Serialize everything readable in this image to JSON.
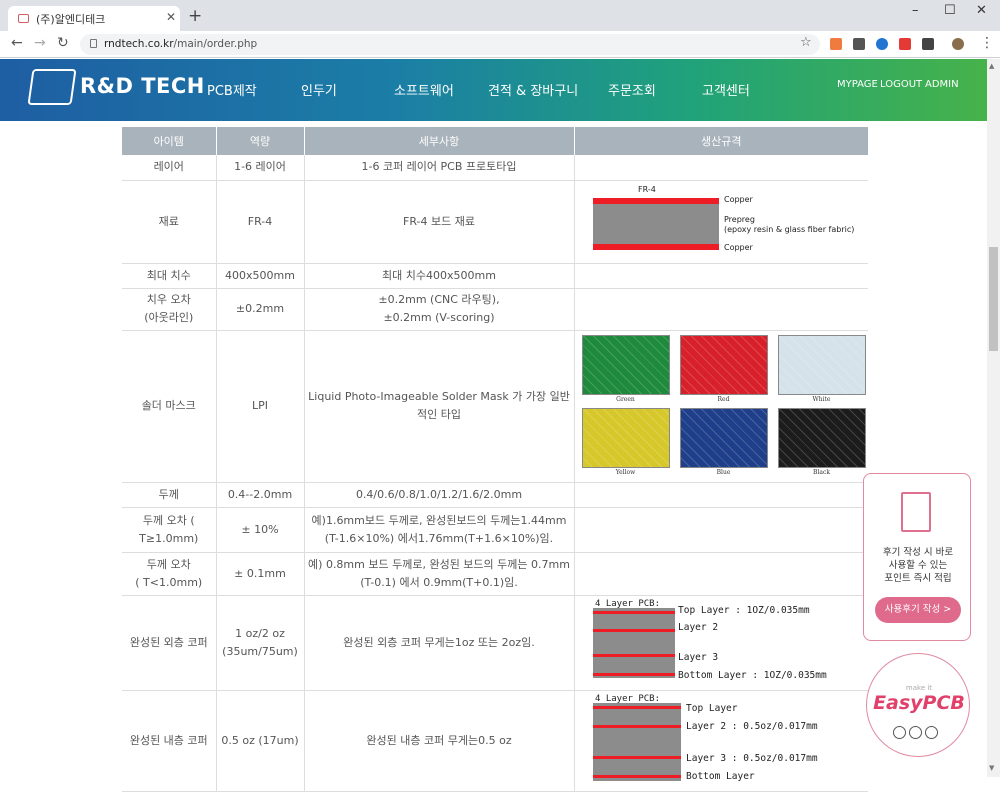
{
  "browser": {
    "tab_title": "(주)알엔디테크",
    "tab_close": "✕",
    "new_tab": "+",
    "url_host": "rndtech.co.kr",
    "url_path": "/main/order.php",
    "win_min": "–",
    "win_max": "☐",
    "win_close": "✕",
    "back": "←",
    "forward": "→",
    "reload": "↻",
    "star": "☆",
    "menu_dots": "⋮",
    "ext_colors": [
      "#f07b3f",
      "#555555",
      "#2276d2",
      "#e53935",
      "#444444",
      "#8a6d4b"
    ]
  },
  "site": {
    "logo_text": "R&D TECH",
    "menu": [
      "PCB제작",
      "인두기",
      "소프트웨어",
      "견적 & 장바구니",
      "주문조회",
      "고객센터"
    ],
    "user_menu": [
      "MYPAGE",
      "LOGOUT",
      "ADMIN"
    ]
  },
  "table": {
    "headers": [
      "아이템",
      "역량",
      "세부사항",
      "생산규격"
    ],
    "rows": [
      {
        "item": "레이어",
        "cap": "1-6 레이어",
        "detail": "1-6 코퍼 레이어 PCB 프로토타입"
      },
      {
        "item": "재료",
        "cap": "FR-4",
        "detail": "FR-4 보드 재료"
      },
      {
        "item": "최대 치수",
        "cap": "400x500mm",
        "detail": "최대 치수400x500mm"
      },
      {
        "item": "치우 오차\n(아웃라인)",
        "cap": "±0.2mm",
        "detail": "±0.2mm (CNC 라우팅),\n±0.2mm (V-scoring)"
      },
      {
        "item": "솔더 마스크",
        "cap": "LPI",
        "detail": "Liquid Photo-Imageable Solder Mask 가 가장 일반적인 타입"
      },
      {
        "item": "두께",
        "cap": "0.4--2.0mm",
        "detail": "0.4/0.6/0.8/1.0/1.2/1.6/2.0mm"
      },
      {
        "item": "두께 오차 ( T≥1.0mm)",
        "cap": "± 10%",
        "detail": "예)1.6mm보드 두께로, 완성된보드의 두께는1.44mm\n(T-1.6×10%) 에서1.76mm(T+1.6×10%)임."
      },
      {
        "item": "두께 오차\n( T<1.0mm)",
        "cap": "± 0.1mm",
        "detail": "예) 0.8mm 보드 두께로, 완성된 보드의 두께는 0.7mm\n(T-0.1) 에서 0.9mm(T+0.1)임."
      },
      {
        "item": "완성된 외층 코퍼",
        "cap": "1 oz/2 oz (35um/75um)",
        "detail": "완성된 외층 코퍼 무게는1oz 또는 2oz임."
      },
      {
        "item": "완성된 내층 코퍼",
        "cap": "0.5 oz (17um)",
        "detail": "완성된 내층 코퍼 무게는0.5 oz"
      }
    ]
  },
  "fr4_diagram": {
    "label": "FR-4",
    "copper_top": "Copper",
    "prepreg": "Prepreg",
    "prepreg_note": "(epoxy resin & glass fiber fabric)",
    "copper_bottom": "Copper"
  },
  "soldermask_colors": [
    {
      "name": "Green",
      "color": "#1d8a3c"
    },
    {
      "name": "Red",
      "color": "#d8202a"
    },
    {
      "name": "White",
      "color": "#d4e2ea"
    },
    {
      "name": "Yellow",
      "color": "#d6c82a"
    },
    {
      "name": "Blue",
      "color": "#1f3f8a"
    },
    {
      "name": "Black",
      "color": "#1c1c1c"
    }
  ],
  "outer_diagram": {
    "title": "4 Layer PCB:",
    "labels": [
      "Top Layer : 1OZ/0.035mm",
      "Layer 2",
      "Layer 3",
      "Bottom Layer : 1OZ/0.035mm"
    ]
  },
  "inner_diagram": {
    "title": "4 Layer PCB:",
    "labels": [
      "Top Layer",
      "Layer 2 : 0.5oz/0.017mm",
      "Layer 3 : 0.5oz/0.017mm",
      "Bottom Layer"
    ]
  },
  "review_widget": {
    "text": "후기 작성 시 바로\n사용할 수 있는\n포인트 즉시 적립",
    "button": "사용후기 작성 >"
  },
  "easypcb": {
    "make_it": "make it",
    "brand": "EasyPCB"
  },
  "colors": {
    "copper": "#ee1c24",
    "core": "#8c8c8c",
    "header_bg": "#a9b3bb",
    "accent_pink": "#e06a8c"
  }
}
